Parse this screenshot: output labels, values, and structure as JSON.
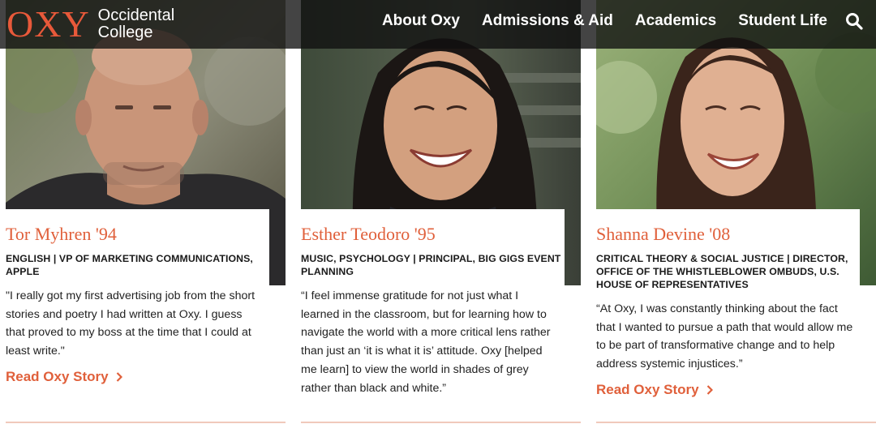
{
  "header": {
    "logo_mark": "OXY",
    "logo_line1": "Occidental",
    "logo_line2": "College",
    "nav": [
      "About Oxy",
      "Admissions & Aid",
      "Academics",
      "Student Life"
    ],
    "search_icon": "search-icon"
  },
  "colors": {
    "accent": "#e0603b",
    "header_bg": "#0f0f0f"
  },
  "cards": [
    {
      "name": "Tor Myhren '94",
      "role": "ENGLISH | VP OF MARKETING COMMUNICATIONS, APPLE",
      "quote": "\"I really got my first advertising job from the short stories and poetry I had written at Oxy. I guess that proved to my boss at the time that I could at least write.\"",
      "link": "Read Oxy Story"
    },
    {
      "name": "Esther Teodoro '95",
      "role": "MUSIC, PSYCHOLOGY | PRINCIPAL, BIG GIGS EVENT PLANNING",
      "quote": "“I feel immense gratitude for not just what I learned in the classroom, but for learning how to navigate the world with a more critical lens rather than just an ‘it is what it is’ attitude. Oxy [helped me learn] to view the world in shades of grey rather than black and white.”",
      "link": ""
    },
    {
      "name": "Shanna Devine '08",
      "role": "CRITICAL THEORY & SOCIAL JUSTICE | DIRECTOR, OFFICE OF THE WHISTLEBLOWER OMBUDS, U.S. HOUSE OF REPRESENTATIVES",
      "quote": "“At Oxy, I was constantly thinking about the fact that I wanted to pursue a path that would allow me to be part of transformative change and to help address systemic injustices.”",
      "link": "Read Oxy Story"
    }
  ]
}
